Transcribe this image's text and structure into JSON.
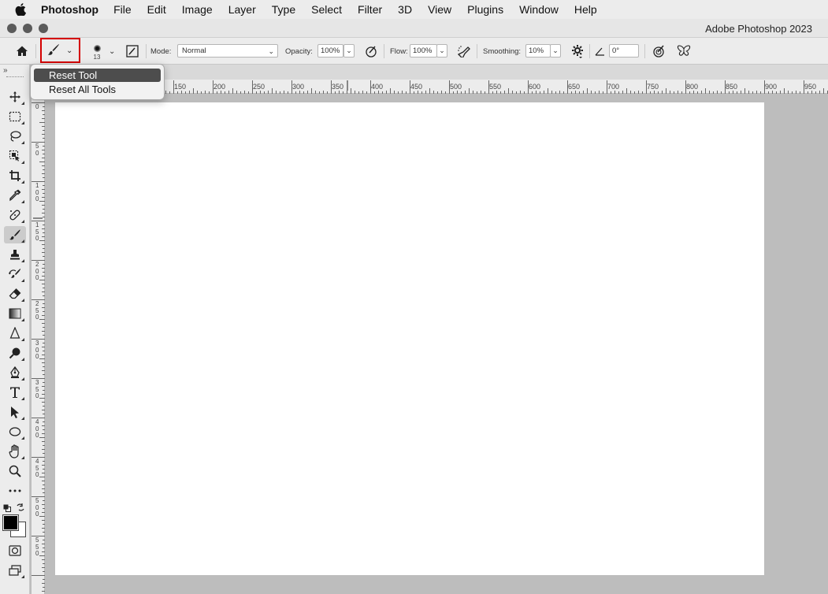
{
  "menubar": {
    "app_name": "Photoshop",
    "items": [
      "File",
      "Edit",
      "Image",
      "Layer",
      "Type",
      "Select",
      "Filter",
      "3D",
      "View",
      "Plugins",
      "Window",
      "Help"
    ]
  },
  "window": {
    "title": "Adobe Photoshop 2023"
  },
  "options_bar": {
    "brush_size": "13",
    "mode_label": "Mode:",
    "mode_value": "Normal",
    "opacity_label": "Opacity:",
    "opacity_value": "100%",
    "flow_label": "Flow:",
    "flow_value": "100%",
    "smoothing_label": "Smoothing:",
    "smoothing_value": "10%",
    "angle_value": "0°"
  },
  "popup_menu": {
    "items": [
      "Reset Tool",
      "Reset All Tools"
    ],
    "selected_index": 0
  },
  "rulers": {
    "horizontal_ticks": [
      "150",
      "200",
      "250",
      "300",
      "350",
      "400",
      "450",
      "500",
      "550",
      "600",
      "650",
      "700",
      "750",
      "800",
      "850",
      "900",
      "950"
    ],
    "vertical_ticks": [
      "0",
      "50",
      "100",
      "150",
      "200",
      "250",
      "300",
      "350",
      "400",
      "450",
      "500",
      "550"
    ]
  },
  "toolbar": {
    "tools": [
      "move-tool",
      "marquee-tool",
      "lasso-tool",
      "object-selection-tool",
      "crop-tool",
      "eyedropper-tool",
      "spot-healing-tool",
      "brush-tool",
      "clone-stamp-tool",
      "history-brush-tool",
      "eraser-tool",
      "gradient-tool",
      "blur-tool",
      "dodge-tool",
      "pen-tool",
      "type-tool",
      "path-selection-tool",
      "ellipse-tool",
      "hand-tool",
      "zoom-tool",
      "more-tools"
    ],
    "active_tool": "brush-tool"
  },
  "colors": {
    "foreground": "#000000",
    "background": "#ffffff",
    "highlight_border": "#d40000"
  }
}
